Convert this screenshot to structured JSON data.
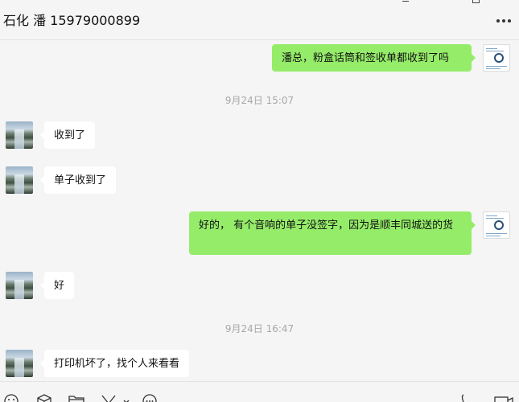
{
  "window": {
    "title": "石化 潘 15979000899",
    "more_label": "更多",
    "close_glyph": "✕"
  },
  "messages": [
    {
      "type": "out",
      "text": "潘总，粉盒话筒和签收单都收到了吗"
    },
    {
      "type": "time",
      "text": "9月24日 15:07"
    },
    {
      "type": "in",
      "text": "收到了"
    },
    {
      "type": "in",
      "text": "单子收到了"
    },
    {
      "type": "out",
      "text": "好的， 有个音响的单子没签字，因为是顺丰同城送的货"
    },
    {
      "type": "in",
      "text": "好"
    },
    {
      "type": "time",
      "text": "9月24日 16:47"
    },
    {
      "type": "in",
      "text": "打印机坏了，找个人来看看"
    }
  ],
  "toolbar": {
    "icons": [
      "emoji-icon",
      "favorites-icon",
      "folder-icon",
      "scissors-icon",
      "chat-history-icon",
      "phone-icon",
      "video-icon"
    ]
  },
  "colors": {
    "outgoing_bubble": "#95ec69",
    "incoming_bubble": "#ffffff",
    "background": "#f5f5f5",
    "timestamp": "#a8a8a8"
  }
}
